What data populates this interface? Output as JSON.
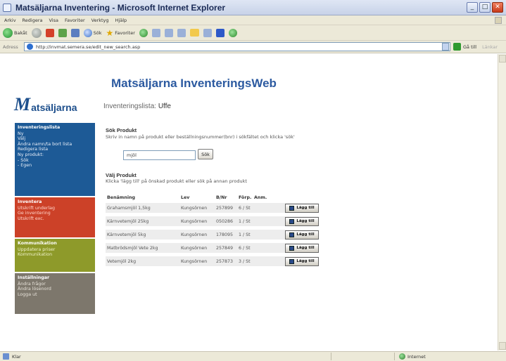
{
  "window": {
    "title": "Matsäljarna Inventering - Microsoft Internet Explorer",
    "buttons": [
      "_",
      "□",
      "✕"
    ]
  },
  "menubar": [
    "Arkiv",
    "Redigera",
    "Visa",
    "Favoriter",
    "Verktyg",
    "Hjälp"
  ],
  "toolbar": {
    "back_label": "Bakåt",
    "search_label": "Sök",
    "favorites_label": "Favoriter"
  },
  "addressbar": {
    "label": "Adress",
    "url": "http://invmat.semera.se/edit_new_search.asp",
    "go_label": "Gå till",
    "links_label": "Länkar"
  },
  "site": {
    "logo_initial": "M",
    "logo_rest": "atsäljarna",
    "title": "Matsäljarna InventeringsWeb",
    "list_label": "Inventeringslista:",
    "list_name": "Uffe"
  },
  "nav": [
    {
      "heading": "Inventeringslista",
      "items": [
        "Ny",
        "Välj",
        "Ändra namn/ta bort lista",
        "Redigera lista",
        "Ny produkt:",
        "- Sök",
        "- Egen"
      ]
    },
    {
      "heading": "Inventera",
      "items": [
        "Utskrift underlag",
        "Ge inventering",
        "Utskrift exc."
      ]
    },
    {
      "heading": "Kommunikation",
      "items": [
        "Uppdatera priser",
        "Kommunikation"
      ]
    },
    {
      "heading": "Inställningar",
      "items": [
        "Ändra frågor",
        "Ändra lösenord",
        "Logga ut"
      ]
    }
  ],
  "search_section": {
    "title": "Sök Produkt",
    "help": "Skriv in namn på produkt eller beställningsnummer(bnr) i sökfältet och klicka 'sök'",
    "value": "mjöl",
    "button": "Sök"
  },
  "select_section": {
    "title": "Välj Produkt",
    "help": "Klicka 'lägg till' på önskad produkt eller sök på annan produkt"
  },
  "table": {
    "headers": [
      "Benämning",
      "Lev",
      "B/Nr",
      "Förp.",
      "Anm."
    ],
    "add_label": "Lägg till",
    "rows": [
      [
        "Grahamsmjöl 1,5kg",
        "Kungsörnen",
        "257899",
        "6 / St",
        ""
      ],
      [
        "Kärnvetemjöl 25kg",
        "Kungsörnen",
        "050286",
        "1 / St",
        ""
      ],
      [
        "Kärnvetemjöl 5kg",
        "Kungsörnen",
        "178095",
        "1 / St",
        ""
      ],
      [
        "Matbrödsmjöl Vete 2kg",
        "Kungsörnen",
        "257849",
        "6 / St",
        ""
      ],
      [
        "Vetemjöl 2kg",
        "Kungsörnen",
        "257873",
        "3 / St",
        ""
      ]
    ]
  },
  "statusbar": {
    "text": "Klar",
    "zone": "Internet"
  }
}
